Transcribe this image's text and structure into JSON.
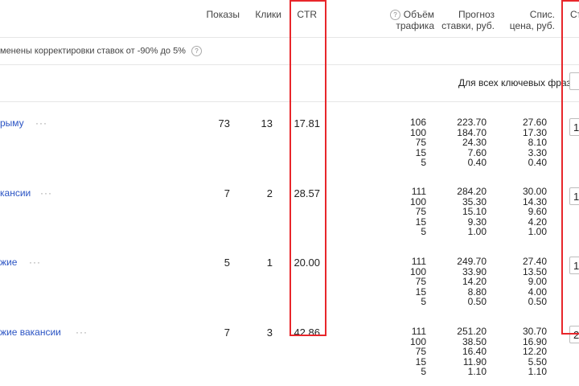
{
  "header": {
    "shows": "Показы",
    "clicks": "Клики",
    "ctr": "CTR",
    "volume_line1": "Объём",
    "volume_line2": "трафика",
    "forecast_line1": "Прогноз",
    "forecast_line2": "ставки, руб.",
    "charged_line1": "Спис.",
    "charged_line2": "цена, руб.",
    "bid_partial": "Ст"
  },
  "adjustment_note": "менены корректировки ставок от -90% до 5%",
  "all_phrases_label": "Для всех ключевых фраз:",
  "rows": [
    {
      "phrase": "рыму",
      "shows": "73",
      "clicks": "13",
      "ctr": "17.81",
      "volumes": [
        "106",
        "100",
        "75",
        "15",
        "5"
      ],
      "forecast": [
        "223.70",
        "184.70",
        "24.30",
        "7.60",
        "0.40"
      ],
      "charged": [
        "27.60",
        "17.30",
        "8.10",
        "3.30",
        "0.40"
      ],
      "bid": "1"
    },
    {
      "phrase": "кансии",
      "shows": "7",
      "clicks": "2",
      "ctr": "28.57",
      "volumes": [
        "111",
        "100",
        "75",
        "15",
        "5"
      ],
      "forecast": [
        "284.20",
        "35.30",
        "15.10",
        "9.30",
        "1.00"
      ],
      "charged": [
        "30.00",
        "14.30",
        "9.60",
        "4.20",
        "1.00"
      ],
      "bid": "1"
    },
    {
      "phrase": "жие",
      "shows": "5",
      "clicks": "1",
      "ctr": "20.00",
      "volumes": [
        "111",
        "100",
        "75",
        "15",
        "5"
      ],
      "forecast": [
        "249.70",
        "33.90",
        "14.20",
        "8.80",
        "0.50"
      ],
      "charged": [
        "27.40",
        "13.50",
        "9.00",
        "4.00",
        "0.50"
      ],
      "bid": "1"
    },
    {
      "phrase": "жие вакансии",
      "shows": "7",
      "clicks": "3",
      "ctr": "42.86",
      "volumes": [
        "111",
        "100",
        "75",
        "15",
        "5"
      ],
      "forecast": [
        "251.20",
        "38.50",
        "16.40",
        "11.90",
        "1.10"
      ],
      "charged": [
        "30.70",
        "16.90",
        "12.20",
        "5.50",
        "1.10"
      ],
      "bid": "2"
    }
  ],
  "colors": {
    "link": "#2b54c4",
    "highlight": "#e8262b"
  },
  "icons": {
    "help": "question-circle-icon",
    "more": "ellipsis-icon"
  }
}
